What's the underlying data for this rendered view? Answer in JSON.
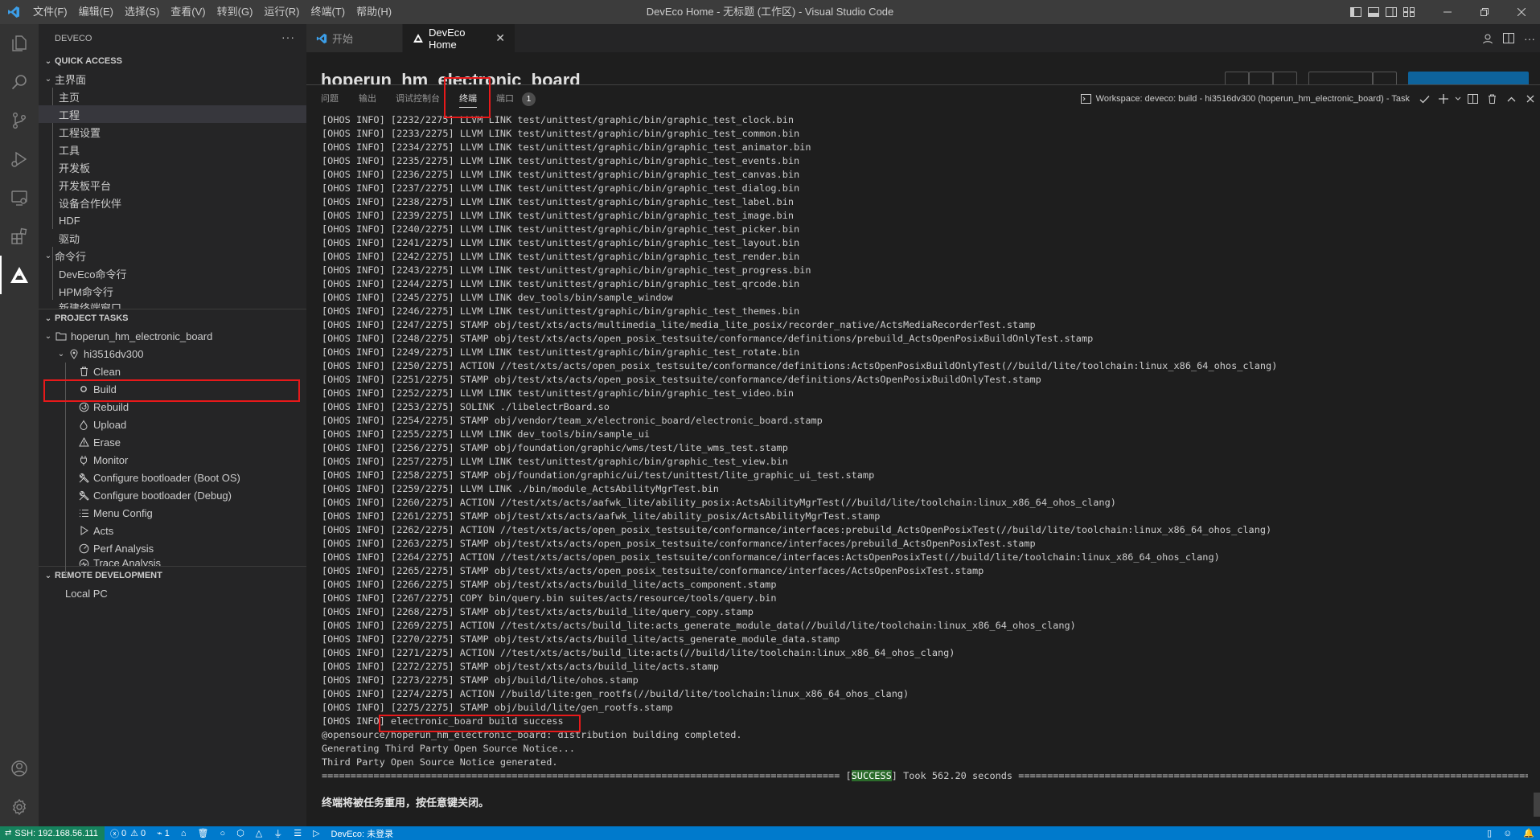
{
  "window": {
    "title": "DevEco Home - 无标题 (工作区) - Visual Studio Code",
    "menu": [
      "文件(F)",
      "编辑(E)",
      "选择(S)",
      "查看(V)",
      "转到(G)",
      "运行(R)",
      "终端(T)",
      "帮助(H)"
    ]
  },
  "activity_bar": {
    "top": [
      "explorer-icon",
      "search-icon",
      "source-control-icon",
      "run-debug-icon",
      "remote-explorer-icon",
      "extensions-icon",
      "deveco-icon"
    ],
    "bottom": [
      "account-icon",
      "manage-gear-icon"
    ]
  },
  "sidebar": {
    "header": "DEVECO",
    "quick_access": {
      "title": "QUICK ACCESS",
      "main_group": "主界面",
      "main_items": [
        "主页",
        "工程",
        "工程设置",
        "工具",
        "开发板",
        "开发板平台",
        "设备合作伙伴",
        "HDF",
        "驱动"
      ],
      "cli_group": "命令行",
      "cli_items": [
        "DevEco命令行",
        "HPM命令行",
        "新建终端窗口"
      ]
    },
    "project_tasks": {
      "title": "PROJECT TASKS",
      "project": "hoperun_hm_electronic_board",
      "board": "hi3516dv300",
      "tasks": [
        {
          "label": "Clean",
          "icon": "trash-icon"
        },
        {
          "label": "Build",
          "icon": "circle-icon"
        },
        {
          "label": "Rebuild",
          "icon": "rebuild-icon"
        },
        {
          "label": "Upload",
          "icon": "upload-icon"
        },
        {
          "label": "Erase",
          "icon": "erase-icon"
        },
        {
          "label": "Monitor",
          "icon": "plug-icon"
        },
        {
          "label": "Configure bootloader (Boot OS)",
          "icon": "tools-icon"
        },
        {
          "label": "Configure bootloader (Debug)",
          "icon": "tools-icon"
        },
        {
          "label": "Menu Config",
          "icon": "list-icon"
        },
        {
          "label": "Acts",
          "icon": "play-icon"
        },
        {
          "label": "Perf Analysis",
          "icon": "speed-icon"
        },
        {
          "label": "Trace Analysis",
          "icon": "trace-icon"
        }
      ]
    },
    "remote_development": {
      "title": "REMOTE DEVELOPMENT",
      "items": [
        "Local PC"
      ]
    }
  },
  "tabs": [
    {
      "label": "开始",
      "active": false
    },
    {
      "label": "DevEco Home",
      "active": true
    }
  ],
  "editor": {
    "page_title": "hoperun_hm_electronic_board"
  },
  "panel": {
    "tabs": [
      "问题",
      "输出",
      "调试控制台",
      "终端",
      "端口"
    ],
    "ports_badge": "1",
    "task_label": "Workspace: deveco: build - hi3516dv300 (hoperun_hm_electronic_board) - Task",
    "lines": [
      "[OHOS INFO] [2232/2275] LLVM LINK test/unittest/graphic/bin/graphic_test_clock.bin",
      "[OHOS INFO] [2233/2275] LLVM LINK test/unittest/graphic/bin/graphic_test_common.bin",
      "[OHOS INFO] [2234/2275] LLVM LINK test/unittest/graphic/bin/graphic_test_animator.bin",
      "[OHOS INFO] [2235/2275] LLVM LINK test/unittest/graphic/bin/graphic_test_events.bin",
      "[OHOS INFO] [2236/2275] LLVM LINK test/unittest/graphic/bin/graphic_test_canvas.bin",
      "[OHOS INFO] [2237/2275] LLVM LINK test/unittest/graphic/bin/graphic_test_dialog.bin",
      "[OHOS INFO] [2238/2275] LLVM LINK test/unittest/graphic/bin/graphic_test_label.bin",
      "[OHOS INFO] [2239/2275] LLVM LINK test/unittest/graphic/bin/graphic_test_image.bin",
      "[OHOS INFO] [2240/2275] LLVM LINK test/unittest/graphic/bin/graphic_test_picker.bin",
      "[OHOS INFO] [2241/2275] LLVM LINK test/unittest/graphic/bin/graphic_test_layout.bin",
      "[OHOS INFO] [2242/2275] LLVM LINK test/unittest/graphic/bin/graphic_test_render.bin",
      "[OHOS INFO] [2243/2275] LLVM LINK test/unittest/graphic/bin/graphic_test_progress.bin",
      "[OHOS INFO] [2244/2275] LLVM LINK test/unittest/graphic/bin/graphic_test_qrcode.bin",
      "[OHOS INFO] [2245/2275] LLVM LINK dev_tools/bin/sample_window",
      "[OHOS INFO] [2246/2275] LLVM LINK test/unittest/graphic/bin/graphic_test_themes.bin",
      "[OHOS INFO] [2247/2275] STAMP obj/test/xts/acts/multimedia_lite/media_lite_posix/recorder_native/ActsMediaRecorderTest.stamp",
      "[OHOS INFO] [2248/2275] STAMP obj/test/xts/acts/open_posix_testsuite/conformance/definitions/prebuild_ActsOpenPosixBuildOnlyTest.stamp",
      "[OHOS INFO] [2249/2275] LLVM LINK test/unittest/graphic/bin/graphic_test_rotate.bin",
      "[OHOS INFO] [2250/2275] ACTION //test/xts/acts/open_posix_testsuite/conformance/definitions:ActsOpenPosixBuildOnlyTest(//build/lite/toolchain:linux_x86_64_ohos_clang)",
      "[OHOS INFO] [2251/2275] STAMP obj/test/xts/acts/open_posix_testsuite/conformance/definitions/ActsOpenPosixBuildOnlyTest.stamp",
      "[OHOS INFO] [2252/2275] LLVM LINK test/unittest/graphic/bin/graphic_test_video.bin",
      "[OHOS INFO] [2253/2275] SOLINK ./libelectrBoard.so",
      "[OHOS INFO] [2254/2275] STAMP obj/vendor/team_x/electronic_board/electronic_board.stamp",
      "[OHOS INFO] [2255/2275] LLVM LINK dev_tools/bin/sample_ui",
      "[OHOS INFO] [2256/2275] STAMP obj/foundation/graphic/wms/test/lite_wms_test.stamp",
      "[OHOS INFO] [2257/2275] LLVM LINK test/unittest/graphic/bin/graphic_test_view.bin",
      "[OHOS INFO] [2258/2275] STAMP obj/foundation/graphic/ui/test/unittest/lite_graphic_ui_test.stamp",
      "[OHOS INFO] [2259/2275] LLVM LINK ./bin/module_ActsAbilityMgrTest.bin",
      "[OHOS INFO] [2260/2275] ACTION //test/xts/acts/aafwk_lite/ability_posix:ActsAbilityMgrTest(//build/lite/toolchain:linux_x86_64_ohos_clang)",
      "[OHOS INFO] [2261/2275] STAMP obj/test/xts/acts/aafwk_lite/ability_posix/ActsAbilityMgrTest.stamp",
      "[OHOS INFO] [2262/2275] ACTION //test/xts/acts/open_posix_testsuite/conformance/interfaces:prebuild_ActsOpenPosixTest(//build/lite/toolchain:linux_x86_64_ohos_clang)",
      "[OHOS INFO] [2263/2275] STAMP obj/test/xts/acts/open_posix_testsuite/conformance/interfaces/prebuild_ActsOpenPosixTest.stamp",
      "[OHOS INFO] [2264/2275] ACTION //test/xts/acts/open_posix_testsuite/conformance/interfaces:ActsOpenPosixTest(//build/lite/toolchain:linux_x86_64_ohos_clang)",
      "[OHOS INFO] [2265/2275] STAMP obj/test/xts/acts/open_posix_testsuite/conformance/interfaces/ActsOpenPosixTest.stamp",
      "[OHOS INFO] [2266/2275] STAMP obj/test/xts/acts/build_lite/acts_component.stamp",
      "[OHOS INFO] [2267/2275] COPY bin/query.bin suites/acts/resource/tools/query.bin",
      "[OHOS INFO] [2268/2275] STAMP obj/test/xts/acts/build_lite/query_copy.stamp",
      "[OHOS INFO] [2269/2275] ACTION //test/xts/acts/build_lite:acts_generate_module_data(//build/lite/toolchain:linux_x86_64_ohos_clang)",
      "[OHOS INFO] [2270/2275] STAMP obj/test/xts/acts/build_lite/acts_generate_module_data.stamp",
      "[OHOS INFO] [2271/2275] ACTION //test/xts/acts/build_lite:acts(//build/lite/toolchain:linux_x86_64_ohos_clang)",
      "[OHOS INFO] [2272/2275] STAMP obj/test/xts/acts/build_lite/acts.stamp",
      "[OHOS INFO] [2273/2275] STAMP obj/build/lite/ohos.stamp",
      "[OHOS INFO] [2274/2275] ACTION //build/lite:gen_rootfs(//build/lite/toolchain:linux_x86_64_ohos_clang)",
      "[OHOS INFO] [2275/2275] STAMP obj/build/lite/gen_rootfs.stamp",
      "[OHOS INFO] electronic_board build success",
      "@opensource/hoperun_hm_electronic_board: distribution building completed.",
      "Generating Third Party Open Source Notice...",
      "Third Party Open Source Notice generated."
    ],
    "success_rule_left": "==========================================================================================",
    "success_tag": "SUCCESS",
    "success_text": "Took 562.20 seconds",
    "success_rule_right": "==========================================================================================",
    "end_message": "终端将被任务重用，按任意键关闭。"
  },
  "statusbar": {
    "remote": "SSH: 192.168.56.111",
    "errors": "0",
    "warnings": "0",
    "ports": "1",
    "deveco": "DevEco: 未登录"
  },
  "colors": {
    "accent": "#007acc",
    "remote": "#16825d",
    "highlight": "#e8191a"
  }
}
